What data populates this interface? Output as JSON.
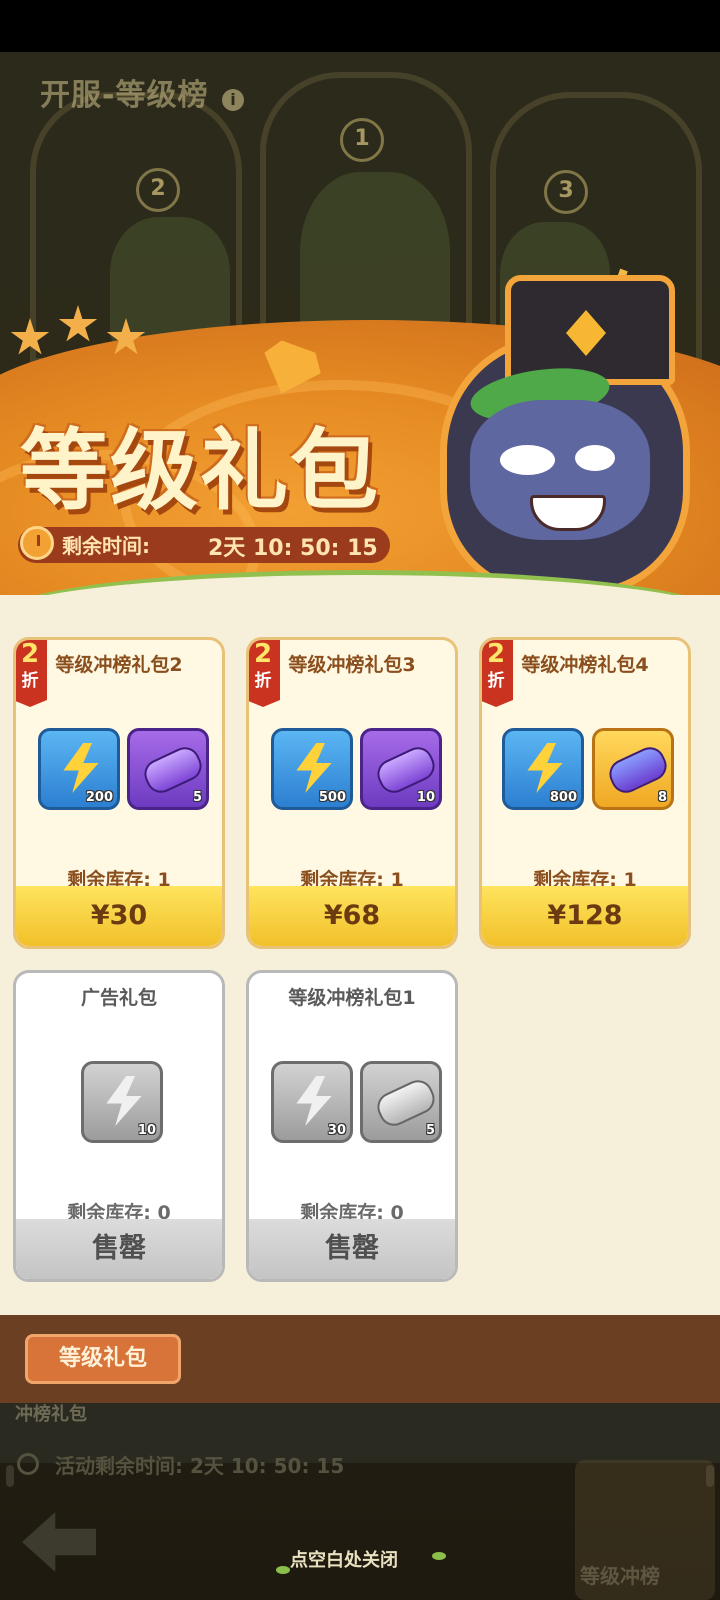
{
  "background": {
    "title": "开服-等级榜",
    "ranks": [
      "1",
      "2",
      "3"
    ]
  },
  "banner": {
    "title": "等级礼包",
    "timer_label": "剩余时间:",
    "timer_value": "2天 10: 50: 15"
  },
  "cards": [
    {
      "title": "等级冲榜礼包2",
      "discount_num": "2",
      "discount_unit": "折",
      "items": [
        {
          "icon": "energy-bolt-icon",
          "count": "200"
        },
        {
          "icon": "capsule-icon",
          "count": "5"
        }
      ],
      "stock": "剩余库存: 1",
      "price": "¥30"
    },
    {
      "title": "等级冲榜礼包3",
      "discount_num": "2",
      "discount_unit": "折",
      "items": [
        {
          "icon": "energy-bolt-icon",
          "count": "500"
        },
        {
          "icon": "capsule-icon",
          "count": "10"
        }
      ],
      "stock": "剩余库存: 1",
      "price": "¥68"
    },
    {
      "title": "等级冲榜礼包4",
      "discount_num": "2",
      "discount_unit": "折",
      "items": [
        {
          "icon": "energy-bolt-icon",
          "count": "800"
        },
        {
          "icon": "capsule-icon",
          "count": "8"
        }
      ],
      "stock": "剩余库存: 1",
      "price": "¥128"
    },
    {
      "title": "广告礼包",
      "items": [
        {
          "icon": "energy-bolt-icon",
          "count": "10"
        }
      ],
      "stock": "剩余库存: 0",
      "price": "售罄"
    },
    {
      "title": "等级冲榜礼包1",
      "items": [
        {
          "icon": "energy-bolt-icon",
          "count": "30"
        },
        {
          "icon": "capsule-icon",
          "count": "5"
        }
      ],
      "stock": "剩余库存: 0",
      "price": "售罄"
    }
  ],
  "tab_bar": {
    "active_tab": "等级礼包"
  },
  "underlay": {
    "title": "冲榜礼包",
    "timer": "活动剩余时间: 2天 10: 50: 15"
  },
  "footer": {
    "close_hint": "点空白处关闭",
    "rank_entry_label": "等级冲榜"
  },
  "colors": {
    "banner_orange": "#e58a22",
    "panel_cream": "#f6f0da",
    "price_gold": "#f1c02a",
    "discount_red": "#c9331f",
    "tab_brown": "#6b3f22"
  }
}
